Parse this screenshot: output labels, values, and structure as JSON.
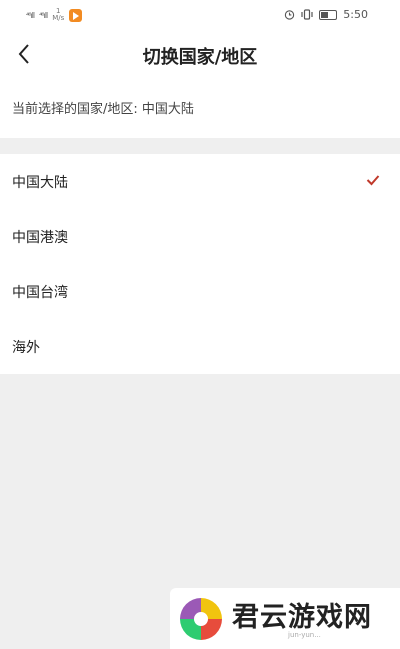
{
  "status_bar": {
    "signal_1": "⁴⁶ıll",
    "signal_2": "⁴⁶ıll",
    "speed_value": "1",
    "speed_unit": "M/s",
    "time": "5:50"
  },
  "header": {
    "title": "切换国家/地区"
  },
  "current": {
    "text": "当前选择的国家/地区: 中国大陆"
  },
  "regions": [
    {
      "label": "中国大陆",
      "selected": true
    },
    {
      "label": "中国港澳",
      "selected": false
    },
    {
      "label": "中国台湾",
      "selected": false
    },
    {
      "label": "海外",
      "selected": false
    }
  ],
  "watermark": {
    "name": "君云游戏网",
    "url": "jun-yun..."
  },
  "colors": {
    "accent": "#c0392b",
    "background": "#efefef"
  }
}
